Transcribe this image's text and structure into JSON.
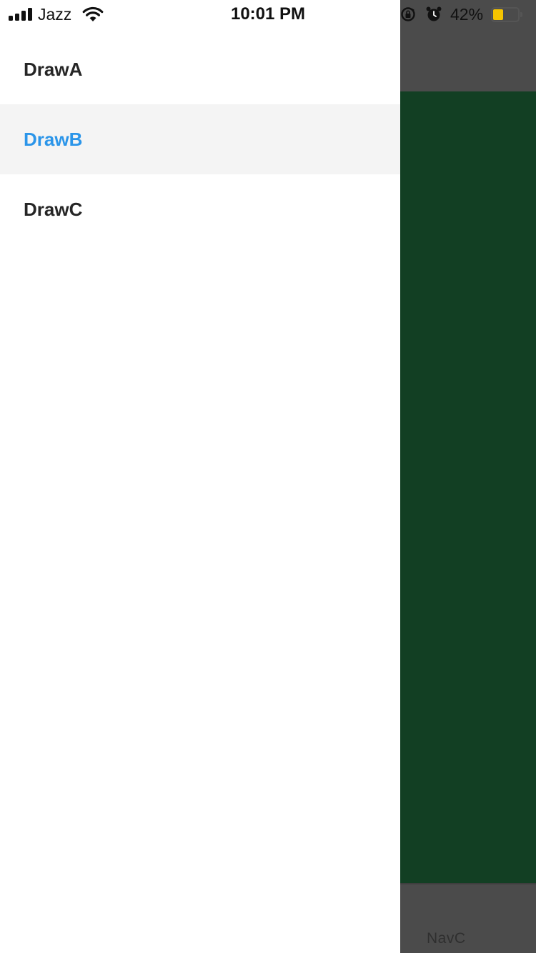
{
  "status_bar": {
    "carrier": "Jazz",
    "time": "10:01 PM",
    "battery_percent_label": "42%",
    "battery_level": 0.42,
    "battery_color": "#f5c400",
    "icons": [
      "signal-bars-icon",
      "wifi-icon",
      "rotation-lock-icon",
      "alarm-icon",
      "battery-icon"
    ]
  },
  "drawer": {
    "items": [
      {
        "label": "DrawA",
        "active": false
      },
      {
        "label": "DrawB",
        "active": true
      },
      {
        "label": "DrawC",
        "active": false
      }
    ],
    "active_color": "#2b95e9",
    "text_color": "#262626"
  },
  "background_app": {
    "tab_label": "NavC",
    "content_color": "#123f23",
    "chrome_color": "#4b4b4b"
  }
}
